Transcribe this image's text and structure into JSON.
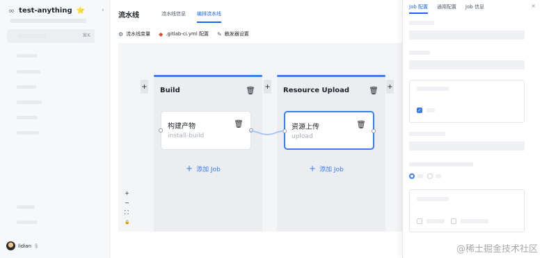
{
  "sidebar": {
    "project_name": "test-anything",
    "project_star": "⭐",
    "infinity_icon": "∞",
    "collapse_icon": "‹",
    "search_shortcut": "⌘K",
    "user_name": "lidian",
    "user_icon": "ꆜ"
  },
  "header": {
    "title": "流水线",
    "tabs": [
      {
        "label": "流水线信息"
      },
      {
        "label": "编排流水线"
      }
    ],
    "toolbar": [
      {
        "icon": "⚙",
        "label": "流水线变量"
      },
      {
        "icon": "◆",
        "label": ".gitlab-ci.yml 配置"
      },
      {
        "icon": "✎",
        "label": "触发器设置"
      }
    ]
  },
  "canvas": {
    "stages": [
      {
        "name": "Build",
        "job": {
          "name": "构建产物",
          "sub": "install-build"
        },
        "add_job": "添加 Job"
      },
      {
        "name": "Resource Upload",
        "job": {
          "name": "资源上传",
          "sub": "upload"
        },
        "add_job": "添加 Job"
      }
    ],
    "plus": "+",
    "trash": "🗑",
    "zoom": {
      "in": "+",
      "out": "−",
      "fit": "⛶",
      "lock": "🔒"
    }
  },
  "panel": {
    "tabs": [
      {
        "label": "Job 配置"
      },
      {
        "label": "通用配置"
      },
      {
        "label": "Job 信息"
      }
    ],
    "close": "×"
  },
  "watermark": "@稀土掘金技术社区",
  "colors": {
    "accent": "#1664ff",
    "stage_bar": "#3a7bf1"
  }
}
